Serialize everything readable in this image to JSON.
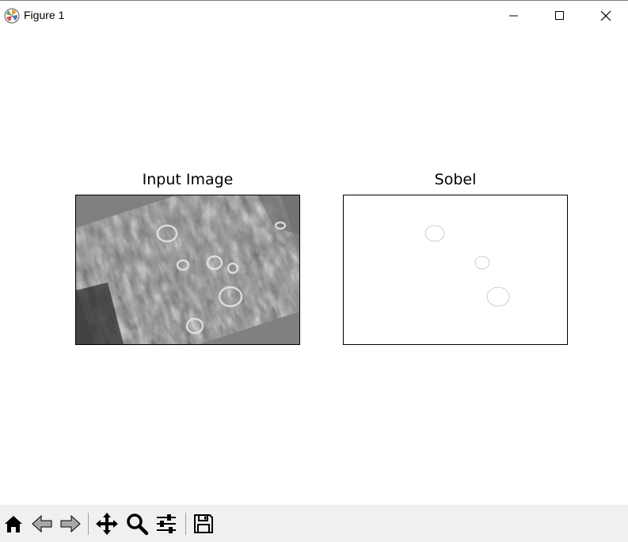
{
  "window": {
    "title": "Figure 1"
  },
  "figure": {
    "left_title": "Input Image",
    "right_title": "Sobel"
  },
  "icons": {
    "app": "matplotlib-logo-icon",
    "minimize": "minimize-icon",
    "maximize": "maximize-icon",
    "close": "close-icon",
    "home": "home-icon",
    "back": "back-arrow-icon",
    "forward": "forward-arrow-icon",
    "pan": "pan-move-icon",
    "zoom": "zoom-magnifier-icon",
    "subplots": "configure-subplots-icon",
    "save": "save-floppy-icon"
  }
}
